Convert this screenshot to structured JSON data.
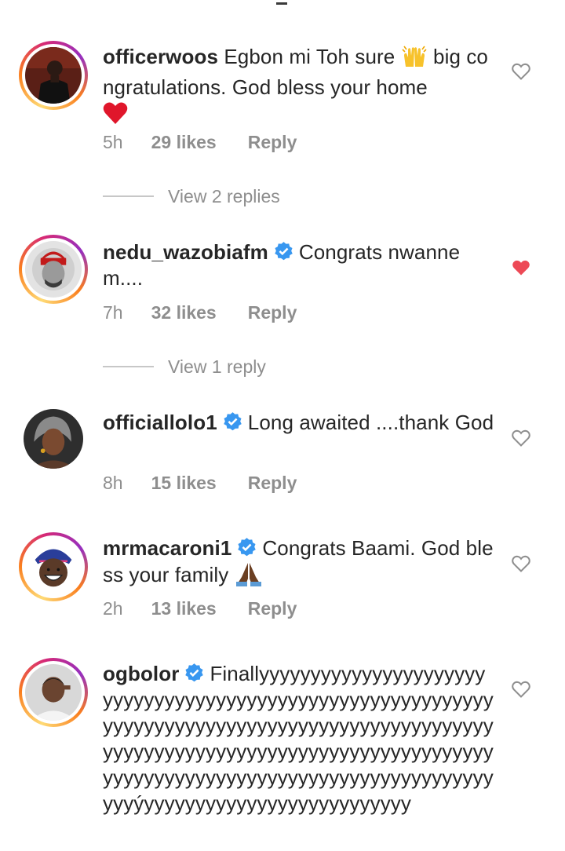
{
  "comments": [
    {
      "username": "officerwoos",
      "verified": false,
      "text_part1": "Egbon mi Toh sure",
      "text_part2": "big congratulations. God bless your home",
      "time": "5h",
      "likes": "29 likes",
      "reply": "Reply",
      "liked": false,
      "view_replies": "View 2 replies"
    },
    {
      "username": "nedu_wazobiafm",
      "verified": true,
      "text": "Congrats nwannem....",
      "time": "7h",
      "likes": "32 likes",
      "reply": "Reply",
      "liked": true,
      "view_replies": "View 1 reply"
    },
    {
      "username": "officiallolo1",
      "verified": true,
      "text": "Long awaited ....thank God",
      "time": "8h",
      "likes": "15 likes",
      "reply": "Reply",
      "liked": false
    },
    {
      "username": "mrmacaroni1",
      "verified": true,
      "text": "Congrats Baami. God bless your family",
      "time": "2h",
      "likes": "13 likes",
      "reply": "Reply",
      "liked": false
    },
    {
      "username": "ogbolor",
      "verified": true,
      "text": "Finallyyyyyyyyyyyyyyyyyyyyyyyyyyyyyyyyyyyyyyyyyyyyyyyyyyyyyyyyyyyyyyyyyyyyyyyyyyyyyyyyyyyyyyyyyyyyyyyyyyyyyyyyyyyyyyyyyyyyyyyyyyyyyyyyyyyyyyyyyyyyyyyyyyyyyyyyyyyyyyyyyyyyyyyyyyyyyyyyyýyyyyyyyyyyyyyyyyyyyyyyyyyy",
      "liked": false
    }
  ],
  "colors": {
    "liked_heart": "#ed4956",
    "verified": "#3897f0",
    "muted": "#8e8e8e"
  },
  "icons": {
    "like": "heart-outline-icon",
    "liked": "heart-filled-icon",
    "verified": "verified-badge-icon"
  }
}
